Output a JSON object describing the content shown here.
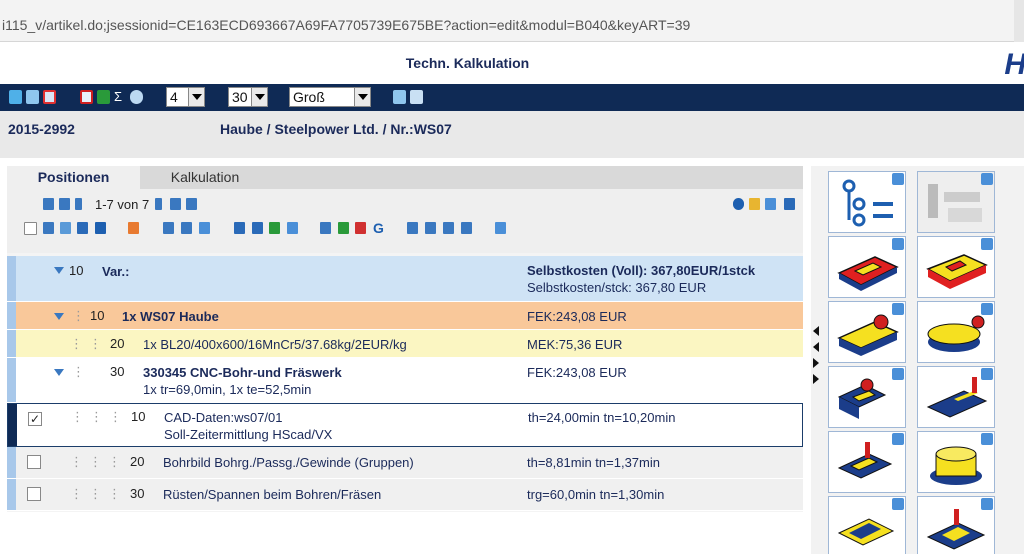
{
  "browser": {
    "url": "i115_v/artikel.do;jsessionid=CE163ECD693667A69FA7705739E675BE?action=edit&modul=B040&keyART=39"
  },
  "header": {
    "title": "Techn. Kalkulation",
    "logo": "H"
  },
  "toolbar": {
    "select1": "4",
    "select2": "30",
    "select3": "Groß"
  },
  "info": {
    "number": "2015-2992",
    "description": "Haube / Steelpower Ltd. / Nr.:WS07"
  },
  "tabs": [
    {
      "label": "Positionen"
    },
    {
      "label": "Kalkulation"
    }
  ],
  "pager": {
    "text": "1-7 von 7"
  },
  "rows": [
    {
      "num": "10",
      "line1": "Var.:",
      "line2": "",
      "val1": "Selbstkosten (Voll): 367,80EUR/1stck",
      "val2": "Selbstkosten/stck: 367,80 EUR"
    },
    {
      "num": "10",
      "line1": "1x WS07 Haube",
      "line2": "",
      "val1": "FEK:243,08 EUR",
      "val2": ""
    },
    {
      "num": "20",
      "line1": "1x BL20/400x600/16MnCr5/37.68kg/2EUR/kg",
      "line2": "",
      "val1": "MEK:75,36 EUR",
      "val2": ""
    },
    {
      "num": "30",
      "line1": "330345 CNC-Bohr-und Fräswerk",
      "line2": "1x tr=69,0min, 1x te=52,5min",
      "val1": "FEK:243,08 EUR",
      "val2": ""
    },
    {
      "num": "10",
      "line1": "CAD-Daten:ws07/01",
      "line2": "Soll-Zeitermittlung HScad/VX",
      "val1": "th=24,00min tn=10,20min",
      "val2": "",
      "checked": "✓"
    },
    {
      "num": "20",
      "line1": "Bohrbild Bohrg./Passg./Gewinde (Gruppen)",
      "line2": "",
      "val1": "th=8,81min tn=1,37min",
      "val2": ""
    },
    {
      "num": "30",
      "line1": "Rüsten/Spannen beim Bohren/Fräsen",
      "line2": "",
      "val1": "trg=60,0min tn=1,30min",
      "val2": ""
    }
  ],
  "colors": {
    "navy": "#0f2a55",
    "row_var": "#cfe3f5",
    "row_ws07": "#f9c89a",
    "row_bl20": "#fbf6c2",
    "accent_red": "#e02020",
    "accent_yellow": "#f5e020"
  }
}
